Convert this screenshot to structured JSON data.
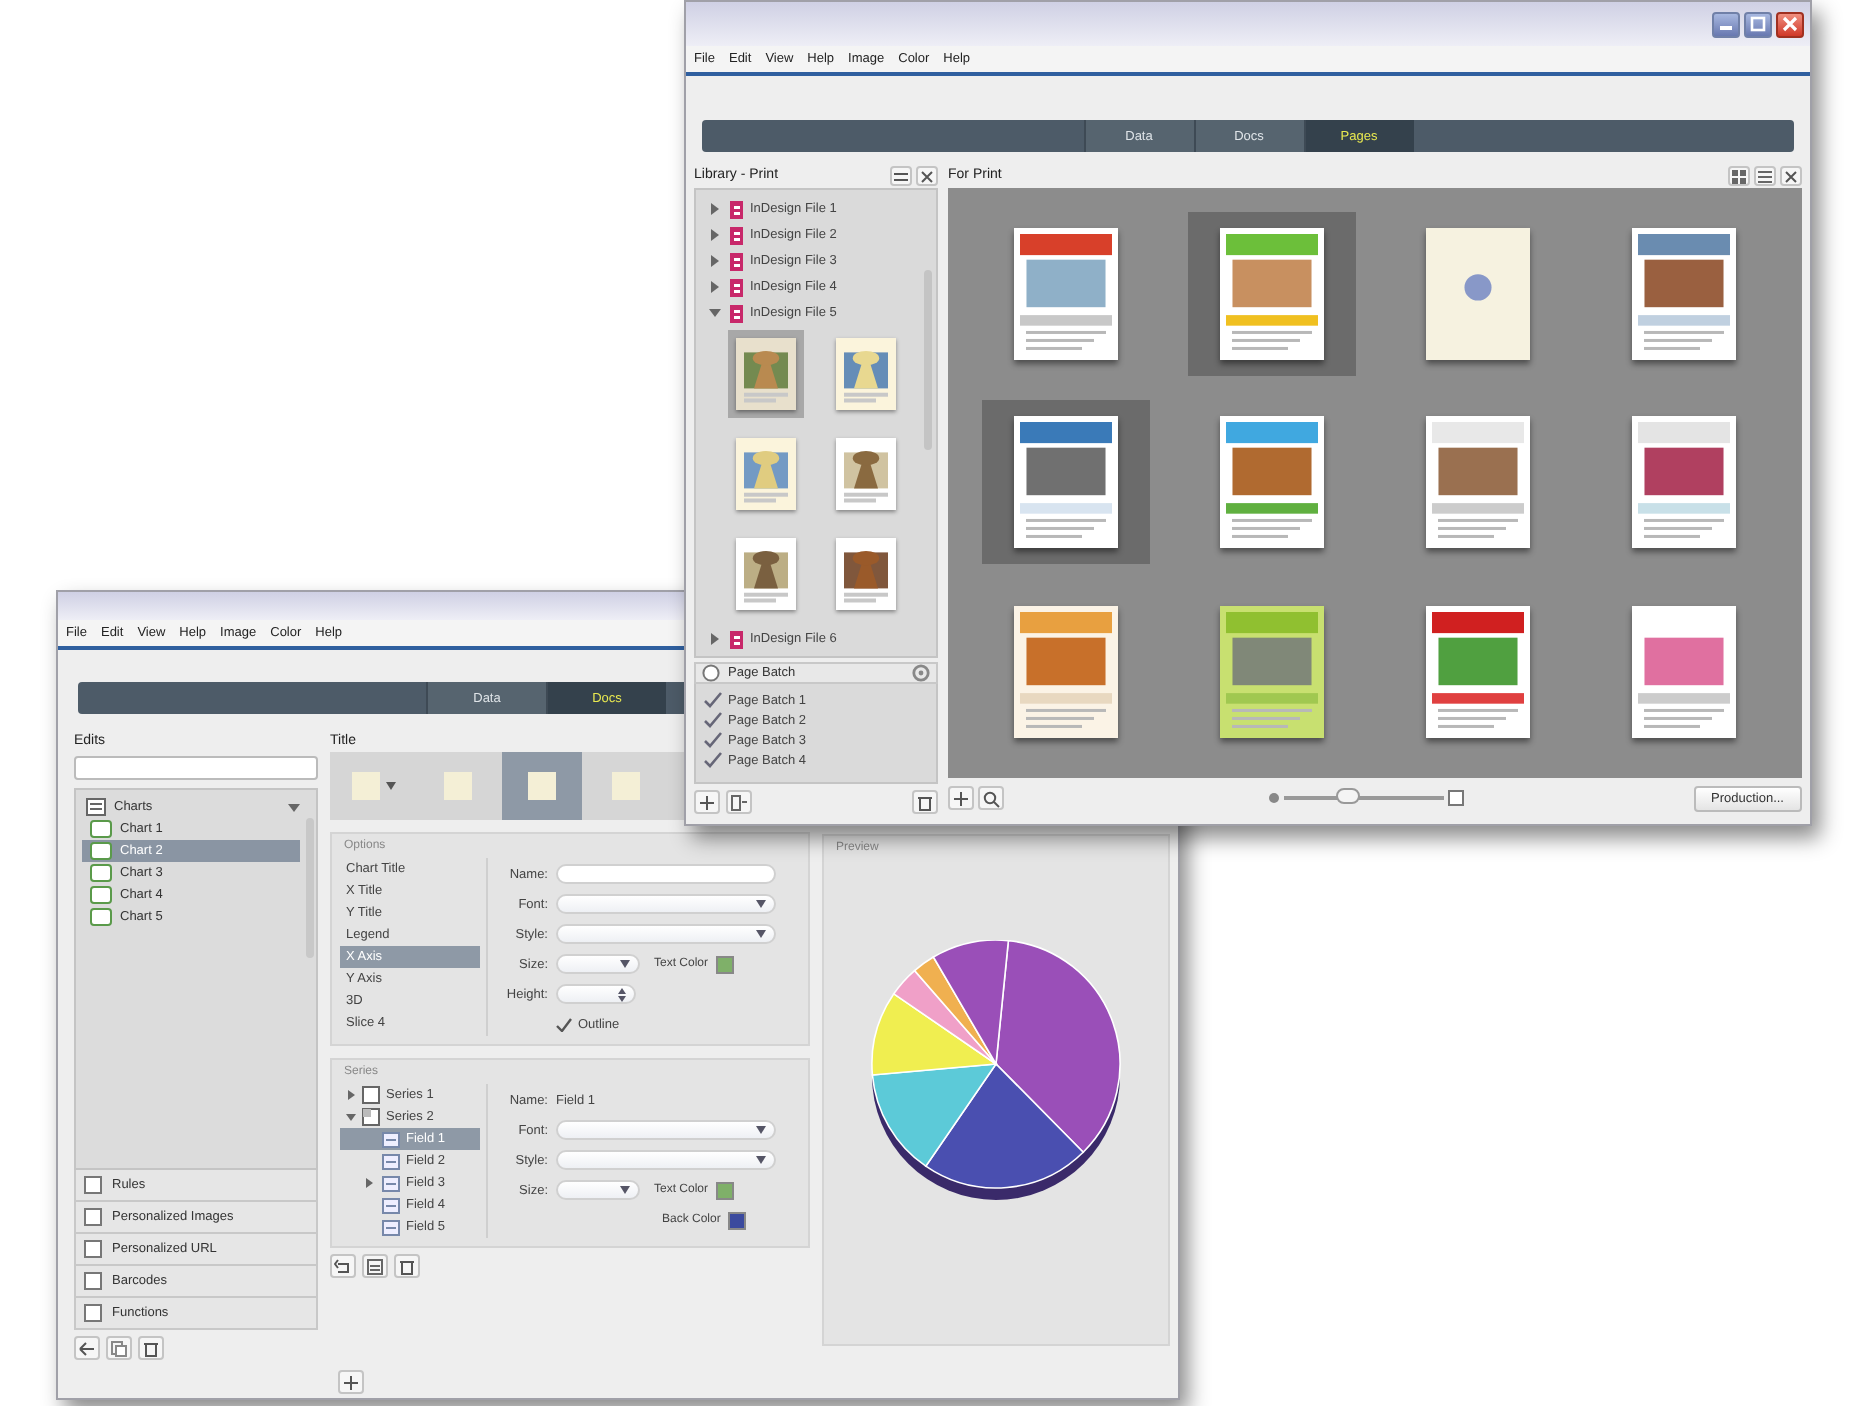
{
  "front": {
    "menu": [
      "File",
      "Edit",
      "View",
      "Help",
      "Image",
      "Color",
      "Help"
    ],
    "tabs": [
      {
        "label": "Data",
        "selected": false
      },
      {
        "label": "Docs",
        "selected": false
      },
      {
        "label": "Pages",
        "selected": true
      }
    ],
    "library": {
      "title": "Library - Print",
      "files": [
        {
          "label": "InDesign File 1",
          "expanded": false
        },
        {
          "label": "InDesign File 2",
          "expanded": false
        },
        {
          "label": "InDesign File 3",
          "expanded": false
        },
        {
          "label": "InDesign File 4",
          "expanded": false
        },
        {
          "label": "InDesign File 5",
          "expanded": true,
          "thumbnails": [
            {
              "kind": "picture",
              "selected": true
            },
            {
              "kind": "picture",
              "selected": false
            },
            {
              "kind": "picture",
              "selected": false
            },
            {
              "kind": "picture",
              "selected": false
            },
            {
              "kind": "picture",
              "selected": false
            },
            {
              "kind": "picture",
              "selected": false
            }
          ]
        },
        {
          "label": "InDesign File 6",
          "expanded": false
        }
      ],
      "batch_header": "Page Batch",
      "batches": [
        {
          "label": "Page Batch 1",
          "checked": true
        },
        {
          "label": "Page Batch 2",
          "checked": true
        },
        {
          "label": "Page Batch 3",
          "checked": true
        },
        {
          "label": "Page Batch 4",
          "checked": true
        }
      ]
    },
    "print": {
      "title": "For Print",
      "pages": [
        {
          "kind": "picture",
          "selected": false
        },
        {
          "kind": "picture",
          "selected": true
        },
        {
          "kind": "picture",
          "selected": false
        },
        {
          "kind": "picture",
          "selected": false
        },
        {
          "kind": "picture",
          "selected": true
        },
        {
          "kind": "picture",
          "selected": false
        },
        {
          "kind": "picture",
          "selected": false
        },
        {
          "kind": "picture",
          "selected": false
        },
        {
          "kind": "picture",
          "selected": false
        },
        {
          "kind": "picture",
          "selected": false
        },
        {
          "kind": "picture",
          "selected": false
        },
        {
          "kind": "picture",
          "selected": false
        }
      ],
      "zoom": {
        "level": 0.4
      },
      "button": "Production..."
    }
  },
  "back": {
    "menu": [
      "File",
      "Edit",
      "View",
      "Help",
      "Image",
      "Color",
      "Help"
    ],
    "tabs": [
      {
        "label": "Data",
        "selected": false
      },
      {
        "label": "Docs",
        "selected": true
      }
    ],
    "sidebar": {
      "title": "Edits",
      "tree": {
        "label": "Charts",
        "expanded": true,
        "children": [
          {
            "label": "Chart 1",
            "selected": false
          },
          {
            "label": "Chart 2",
            "selected": true
          },
          {
            "label": "Chart 3",
            "selected": false
          },
          {
            "label": "Chart 4",
            "selected": false
          },
          {
            "label": "Chart 5",
            "selected": false
          }
        ]
      },
      "categories": [
        "Rules",
        "Personalized Images",
        "Personalized URL",
        "Barcodes",
        "Functions"
      ]
    },
    "editor": {
      "title": "Title",
      "styles": [
        {
          "selected": false
        },
        {
          "selected": false
        },
        {
          "selected": true
        },
        {
          "selected": false
        }
      ],
      "options": {
        "title": "Options",
        "items": [
          {
            "label": "Chart Title",
            "selected": false
          },
          {
            "label": "X Title",
            "selected": false
          },
          {
            "label": "Y Title",
            "selected": false
          },
          {
            "label": "Legend",
            "selected": false
          },
          {
            "label": "X Axis",
            "selected": true
          },
          {
            "label": "Y Axis",
            "selected": false
          },
          {
            "label": "3D",
            "selected": false
          },
          {
            "label": "Slice 4",
            "selected": false
          }
        ],
        "fields": [
          {
            "kind": "text",
            "label": "Name:"
          },
          {
            "kind": "dropdown",
            "label": "Font:"
          },
          {
            "kind": "dropdown",
            "label": "Style:"
          },
          {
            "kind": "size",
            "label": "Size:",
            "color_label": "Text Color",
            "color": "#7fb069"
          },
          {
            "kind": "spinner",
            "label": "Height:"
          },
          {
            "kind": "checkbox",
            "label": "Outline",
            "checked": true
          }
        ]
      },
      "series": {
        "title": "Series",
        "tree": [
          {
            "label": "Series 1",
            "expanded": false
          },
          {
            "label": "Series 2",
            "expanded": true,
            "children": [
              {
                "label": "Field 1",
                "selected": true
              },
              {
                "label": "Field 2",
                "selected": false
              },
              {
                "label": "Field 3",
                "selected": false,
                "expanded": false
              },
              {
                "label": "Field 4",
                "selected": false
              },
              {
                "label": "Field 5",
                "selected": false
              }
            ]
          }
        ],
        "fields": [
          {
            "kind": "value",
            "label": "Name:",
            "value": "Field 1"
          },
          {
            "kind": "dropdown",
            "label": "Font:"
          },
          {
            "kind": "dropdown",
            "label": "Style:"
          },
          {
            "kind": "size",
            "label": "Size:",
            "color_label": "Text Color",
            "color": "#7fb069"
          },
          {
            "kind": "swatch",
            "color_label": "Back Color",
            "color": "#3b4a9e"
          }
        ]
      }
    },
    "preview": {
      "title": "Preview"
    }
  }
}
